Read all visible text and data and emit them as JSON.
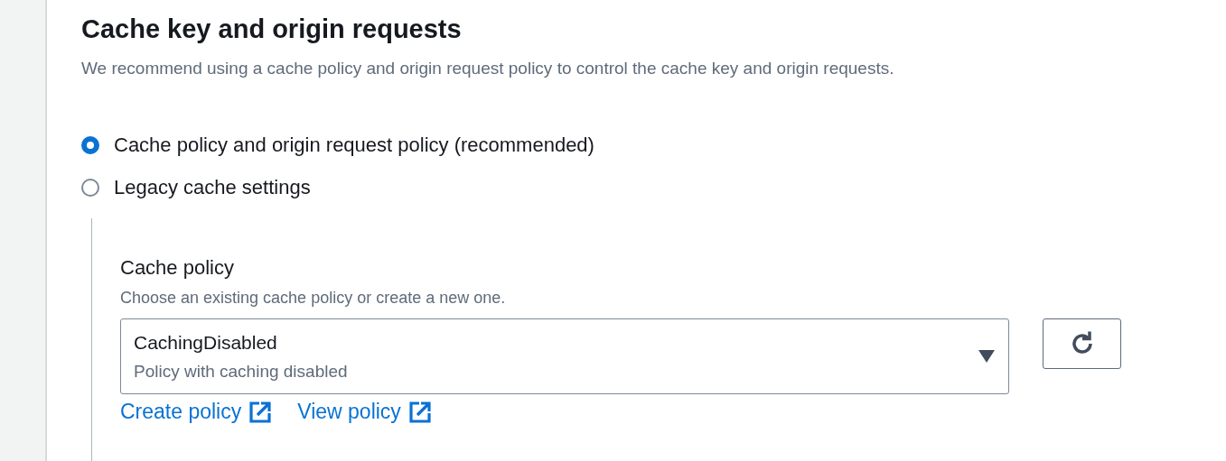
{
  "section": {
    "title": "Cache key and origin requests",
    "description": "We recommend using a cache policy and origin request policy to control the cache key and origin requests."
  },
  "options": [
    {
      "label": "Cache policy and origin request policy (recommended)",
      "selected": true
    },
    {
      "label": "Legacy cache settings",
      "selected": false
    }
  ],
  "cache_policy": {
    "label": "Cache policy",
    "description": "Choose an existing cache policy or create a new one.",
    "value": "CachingDisabled",
    "value_description": "Policy with caching disabled"
  },
  "links": [
    "Create policy",
    "View policy"
  ]
}
